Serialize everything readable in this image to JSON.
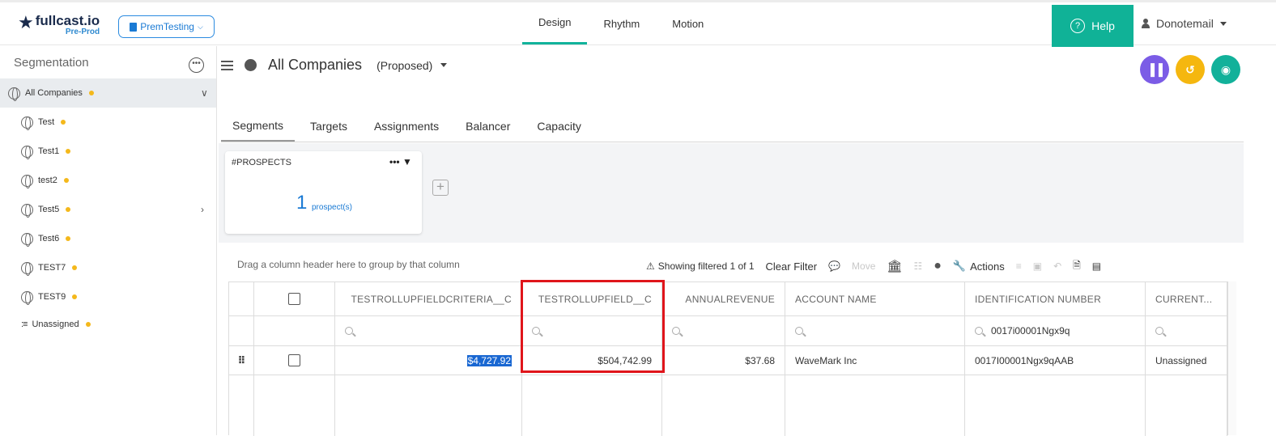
{
  "header": {
    "logo_name": "fullcast.io",
    "logo_sub": "Pre-Prod",
    "env_label": "PremTesting",
    "nav": [
      "Design",
      "Rhythm",
      "Motion"
    ],
    "help_label": "Help",
    "user_label": "Donotemail"
  },
  "sidebar": {
    "title": "Segmentation",
    "items": [
      {
        "label": "All Companies",
        "dot": true
      },
      {
        "label": "Test",
        "dot": true
      },
      {
        "label": "Test1",
        "dot": true
      },
      {
        "label": "test2",
        "dot": true
      },
      {
        "label": "Test5",
        "dot": true
      },
      {
        "label": "Test6",
        "dot": true
      },
      {
        "label": "TEST7",
        "dot": true
      },
      {
        "label": "TEST9",
        "dot": true
      },
      {
        "label": "Unassigned",
        "dot": true
      }
    ]
  },
  "main": {
    "title": "All Companies",
    "state": "(Proposed)",
    "tabs": [
      "Segments",
      "Targets",
      "Assignments",
      "Balancer",
      "Capacity"
    ],
    "card": {
      "title": "#PROSPECTS",
      "count": "1",
      "unit": "prospect(s)"
    },
    "drag_hint": "Drag a column header here to group by that column",
    "toolbar": {
      "showing": "Showing filtered 1 of 1",
      "clear_filter": "Clear Filter",
      "move": "Move",
      "actions": "Actions"
    }
  },
  "grid": {
    "columns": [
      "TESTROLLUPFIELDCRITERIA__C",
      "TESTROLLUPFIELD__C",
      "ANNUALREVENUE",
      "ACCOUNT NAME",
      "IDENTIFICATION NUMBER",
      "CURRENT..."
    ],
    "filter_identification": "0017i00001Ngx9q",
    "rows": [
      [
        "$4,727.92",
        "$504,742.99",
        "$37.68",
        "WaveMark Inc",
        "0017I00001Ngx9qAAB",
        "Unassigned"
      ]
    ]
  },
  "colors": {
    "accent_green": "#10b297",
    "link_blue": "#1a7ad4",
    "status_dot": "#f4b81b",
    "highlight_red": "#e0151b",
    "action_purple": "#7b5ce6",
    "action_yellow": "#f5b70f",
    "action_teal": "#12b19a"
  }
}
